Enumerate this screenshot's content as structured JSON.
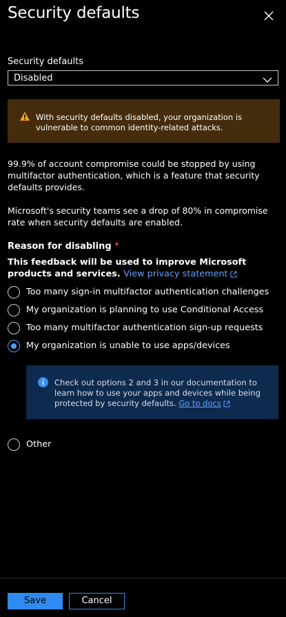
{
  "panel": {
    "title": "Security defaults",
    "close_icon": "close-icon"
  },
  "field": {
    "label": "Security defaults",
    "selected_value": "Disabled"
  },
  "warning": {
    "icon": "warning-icon",
    "text": "With security defaults disabled, your organization is vulnerable to common identity-related attacks."
  },
  "paragraphs": {
    "p1": "99.9% of account compromise could be stopped by using multifactor authentication, which is a feature that security defaults provides.",
    "p2": "Microsoft's security teams see a drop of 80% in compromise rate when security defaults are enabled."
  },
  "reason": {
    "heading": "Reason for disabling",
    "required_marker": "*",
    "feedback_text": "This feedback will be used to improve Microsoft products and services.",
    "privacy_link": "View privacy statement"
  },
  "options": [
    {
      "label": "Too many sign-in multifactor authentication challenges",
      "selected": false
    },
    {
      "label": "My organization is planning to use Conditional Access",
      "selected": false
    },
    {
      "label": "Too many multifactor authentication sign-up requests",
      "selected": false
    },
    {
      "label": "My organization is unable to use apps/devices",
      "selected": true
    },
    {
      "label": "Other",
      "selected": false
    }
  ],
  "info": {
    "icon": "info-icon",
    "text": "Check out options 2 and 3 in our documentation to learn how to use your apps and devices while being protected by security defaults.",
    "link": "Go to docs"
  },
  "buttons": {
    "save": "Save",
    "cancel": "Cancel"
  },
  "colors": {
    "accent": "#2f8bf0",
    "link": "#60a3ff",
    "warning_bg": "#442c0d",
    "info_bg": "#0e2a4f",
    "required": "#ff5e5e"
  }
}
